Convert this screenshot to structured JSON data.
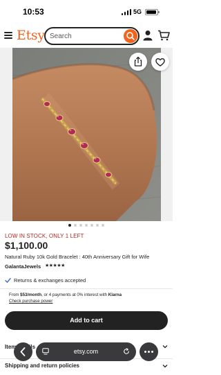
{
  "status_bar": {
    "time": "10:53",
    "network": "5G",
    "battery_level": 0.9
  },
  "header": {
    "logo": "Etsy",
    "search_placeholder": "Search"
  },
  "image_gallery": {
    "dot_count": 7,
    "active_index": 0
  },
  "listing": {
    "stock_notice": "LOW IN STOCK, ONLY 1 LEFT",
    "price": "$1,100.00",
    "title": "Natural Ruby 10k Gold Bracelet : 40th Anniversary Gift for Wife",
    "shop_name": "GalantaJewels",
    "rating_stars": 5,
    "returns_text": "Returns & exchanges accepted",
    "klarna": {
      "prefix": "From ",
      "amount": "$53/month",
      "middle": ", or 4 payments at 0% interest with ",
      "brand": "Klarna"
    },
    "purchase_power_link": "Check purchase power",
    "add_to_cart_label": "Add to cart",
    "item_details_label": "Item details",
    "shipping_label": "Shipping and return policies"
  },
  "safari": {
    "url": "etsy.com"
  },
  "colors": {
    "brand": "#f1641e",
    "stock_alert": "#b3261e",
    "button_dark": "#222222",
    "safari_pill": "#3a3a3c"
  }
}
